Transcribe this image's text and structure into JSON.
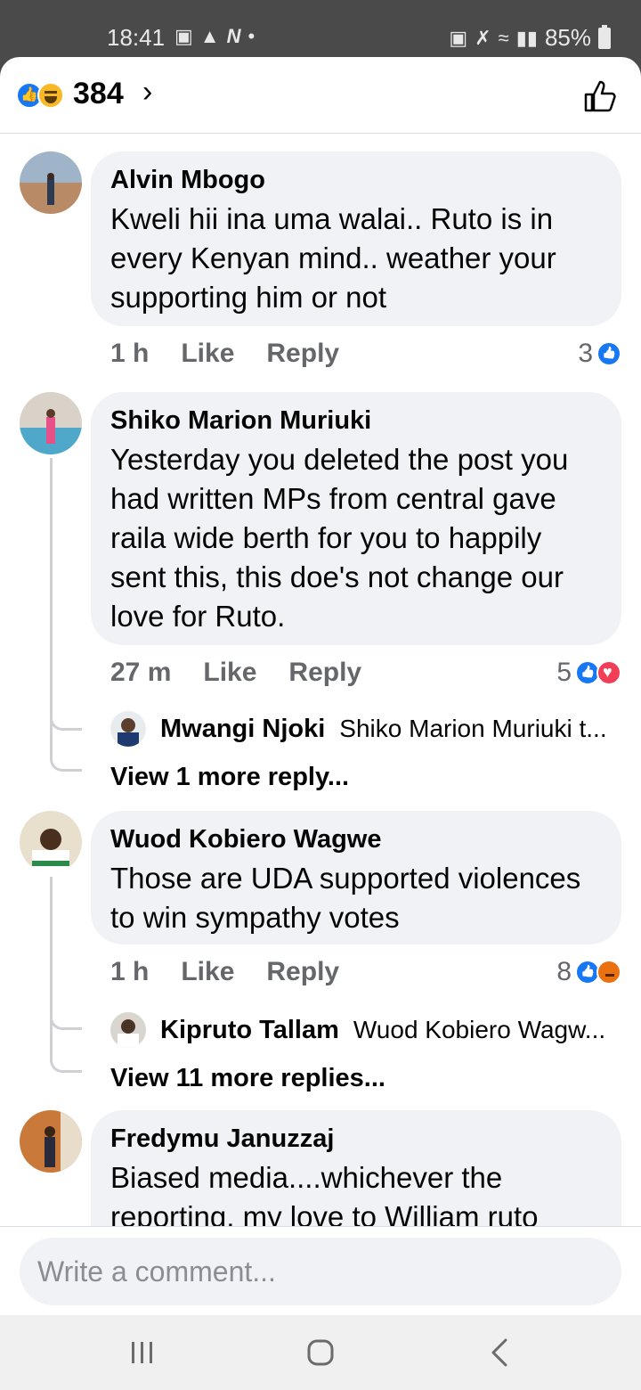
{
  "status_bar": {
    "time": "18:41",
    "battery": "85%"
  },
  "header": {
    "reaction_count": "384",
    "chevron": "›"
  },
  "comments": [
    {
      "name": "Alvin Mbogo",
      "text": "Kweli hii ina uma walai.. Ruto is in every Kenyan mind.. weather your supporting him or not",
      "time": "1 h",
      "like_label": "Like",
      "reply_label": "Reply",
      "reaction_count": "3",
      "reactions": [
        "like-icon"
      ]
    },
    {
      "name": "Shiko Marion Muriuki",
      "text": "Yesterday you deleted the post you had written MPs from central gave raila wide berth for you to happily sent this, this doe's not change our love for Ruto.",
      "time": "27 m",
      "like_label": "Like",
      "reply_label": "Reply",
      "reaction_count": "5",
      "reactions": [
        "like-icon",
        "love-icon"
      ],
      "reply_preview": {
        "name": "Mwangi Njoki",
        "snippet": "Shiko Marion Muriuki t..."
      },
      "more_replies": "View 1 more reply..."
    },
    {
      "name": "Wuod Kobiero Wagwe",
      "text": "Those are UDA supported violences to win sympathy votes",
      "time": "1 h",
      "like_label": "Like",
      "reply_label": "Reply",
      "reaction_count": "8",
      "reactions": [
        "like-icon",
        "angry-icon"
      ],
      "reply_preview": {
        "name": "Kipruto Tallam",
        "snippet": "Wuod Kobiero Wagw..."
      },
      "more_replies": "View 11 more replies..."
    },
    {
      "name": "Fredymu Januzzaj",
      "text": "Biased media....whichever the reporting, my love to William ruto"
    }
  ],
  "composer": {
    "placeholder": "Write a comment..."
  },
  "colors": {
    "accent": "#1877f2",
    "bubble": "#f0f2f5",
    "muted_text": "#65676b"
  }
}
